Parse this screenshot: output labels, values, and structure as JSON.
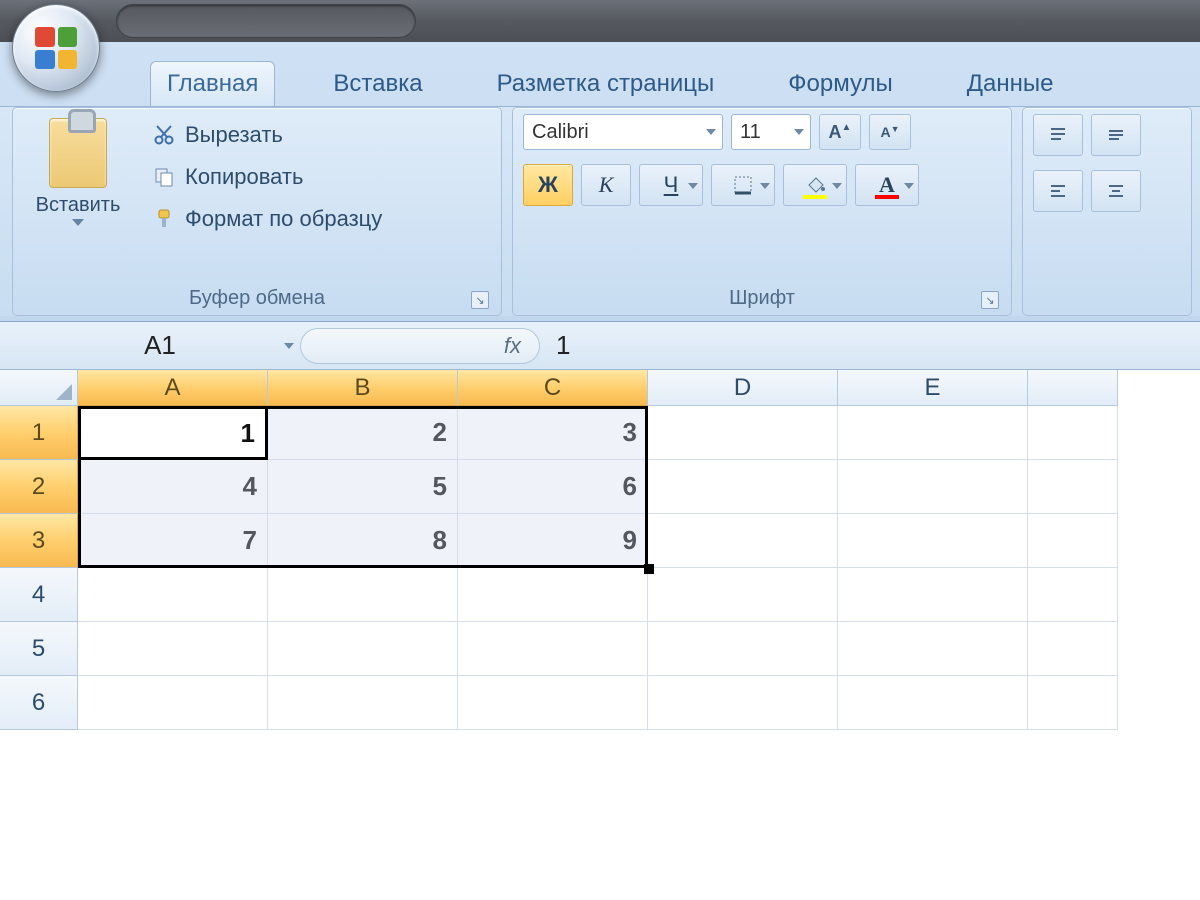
{
  "qat": {
    "save_icon": "save",
    "undo_icon": "undo",
    "redo_icon": "redo",
    "customize_icon": "customize"
  },
  "tabs": {
    "home": "Главная",
    "insert": "Вставка",
    "layout": "Разметка страницы",
    "formulas": "Формулы",
    "data": "Данные"
  },
  "clipboard": {
    "group_label": "Буфер обмена",
    "paste_label": "Вставить",
    "cut_label": "Вырезать",
    "copy_label": "Копировать",
    "format_label": "Формат по образцу"
  },
  "font": {
    "group_label": "Шрифт",
    "name": "Calibri",
    "size": "11",
    "bold": "Ж",
    "italic": "К",
    "underline": "Ч",
    "grow_icon": "A▲",
    "shrink_icon": "A▼",
    "fill_color": "#ffff00",
    "font_color": "#ff0000"
  },
  "alignment": {
    "top_icon": "≡",
    "mid_icon": "≡",
    "bot_icon": "≡",
    "left_icon": "≡",
    "center_icon": "≡",
    "right_icon": "≡"
  },
  "formula_bar": {
    "name_box": "A1",
    "fx_label": "fx",
    "value": "1"
  },
  "grid": {
    "columns": [
      "A",
      "B",
      "C",
      "D",
      "E"
    ],
    "row_numbers": [
      "1",
      "2",
      "3",
      "4",
      "5",
      "6"
    ],
    "data": [
      [
        "1",
        "2",
        "3",
        "",
        ""
      ],
      [
        "4",
        "5",
        "6",
        "",
        ""
      ],
      [
        "7",
        "8",
        "9",
        "",
        ""
      ],
      [
        "",
        "",
        "",
        "",
        ""
      ],
      [
        "",
        "",
        "",
        "",
        ""
      ],
      [
        "",
        "",
        "",
        "",
        ""
      ]
    ],
    "selected_cols": [
      "A",
      "B",
      "C"
    ],
    "selected_rows": [
      "1",
      "2",
      "3"
    ],
    "active_cell_value": "1"
  }
}
